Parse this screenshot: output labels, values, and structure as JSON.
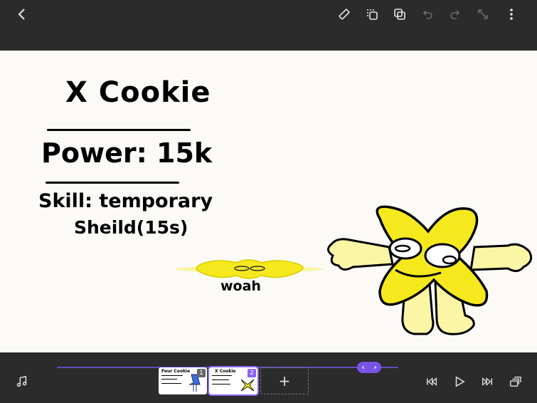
{
  "canvas": {
    "title": "X Cookie",
    "power": "Power: 15k",
    "skill_line1": "Skill: temporary",
    "skill_line2": "Sheild(15s)",
    "caption": "woah"
  },
  "frames": [
    {
      "number": "1",
      "badge_color": "#666666",
      "thumb_title": "Four Cookie"
    },
    {
      "number": "2",
      "badge_color": "#8a63f0",
      "thumb_title": "X Cookie"
    }
  ],
  "timeline": {
    "add_frame_label": "+",
    "scrub_left": "‹",
    "scrub_right": "›"
  },
  "colors": {
    "accent": "#8a63f0",
    "character": "#f5e91d",
    "character_light": "#fbf6a5"
  }
}
